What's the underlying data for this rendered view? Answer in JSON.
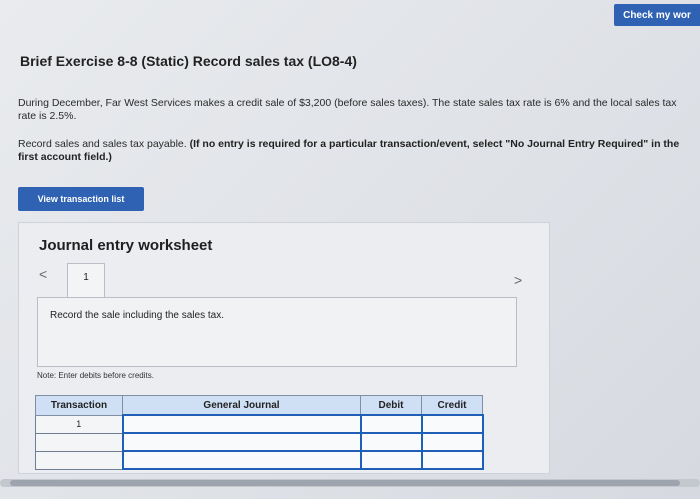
{
  "header": {
    "check_label": "Check my wor"
  },
  "exercise": {
    "title": "Brief Exercise 8-8 (Static) Record sales tax (LO8-4)",
    "paragraph1": "During December, Far West Services makes a credit sale of $3,200 (before sales taxes). The state sales tax rate is 6% and the local sales tax rate is 2.5%.",
    "paragraph2_normal": "Record sales and sales tax payable. ",
    "paragraph2_bold": "(If no entry is required for a particular transaction/event, select \"No Journal Entry Required\" in the first account field.)"
  },
  "buttons": {
    "view_transaction_list": "View transaction list"
  },
  "worksheet": {
    "title": "Journal entry worksheet",
    "nav_prev": "<",
    "nav_next": ">",
    "tab_number": "1",
    "description": "Record the sale including the sales tax.",
    "note": "Note: Enter debits before credits."
  },
  "table": {
    "headers": [
      "Transaction",
      "General Journal",
      "Debit",
      "Credit"
    ],
    "rows": [
      {
        "transaction": "1"
      },
      {
        "transaction": ""
      },
      {
        "transaction": ""
      }
    ]
  }
}
